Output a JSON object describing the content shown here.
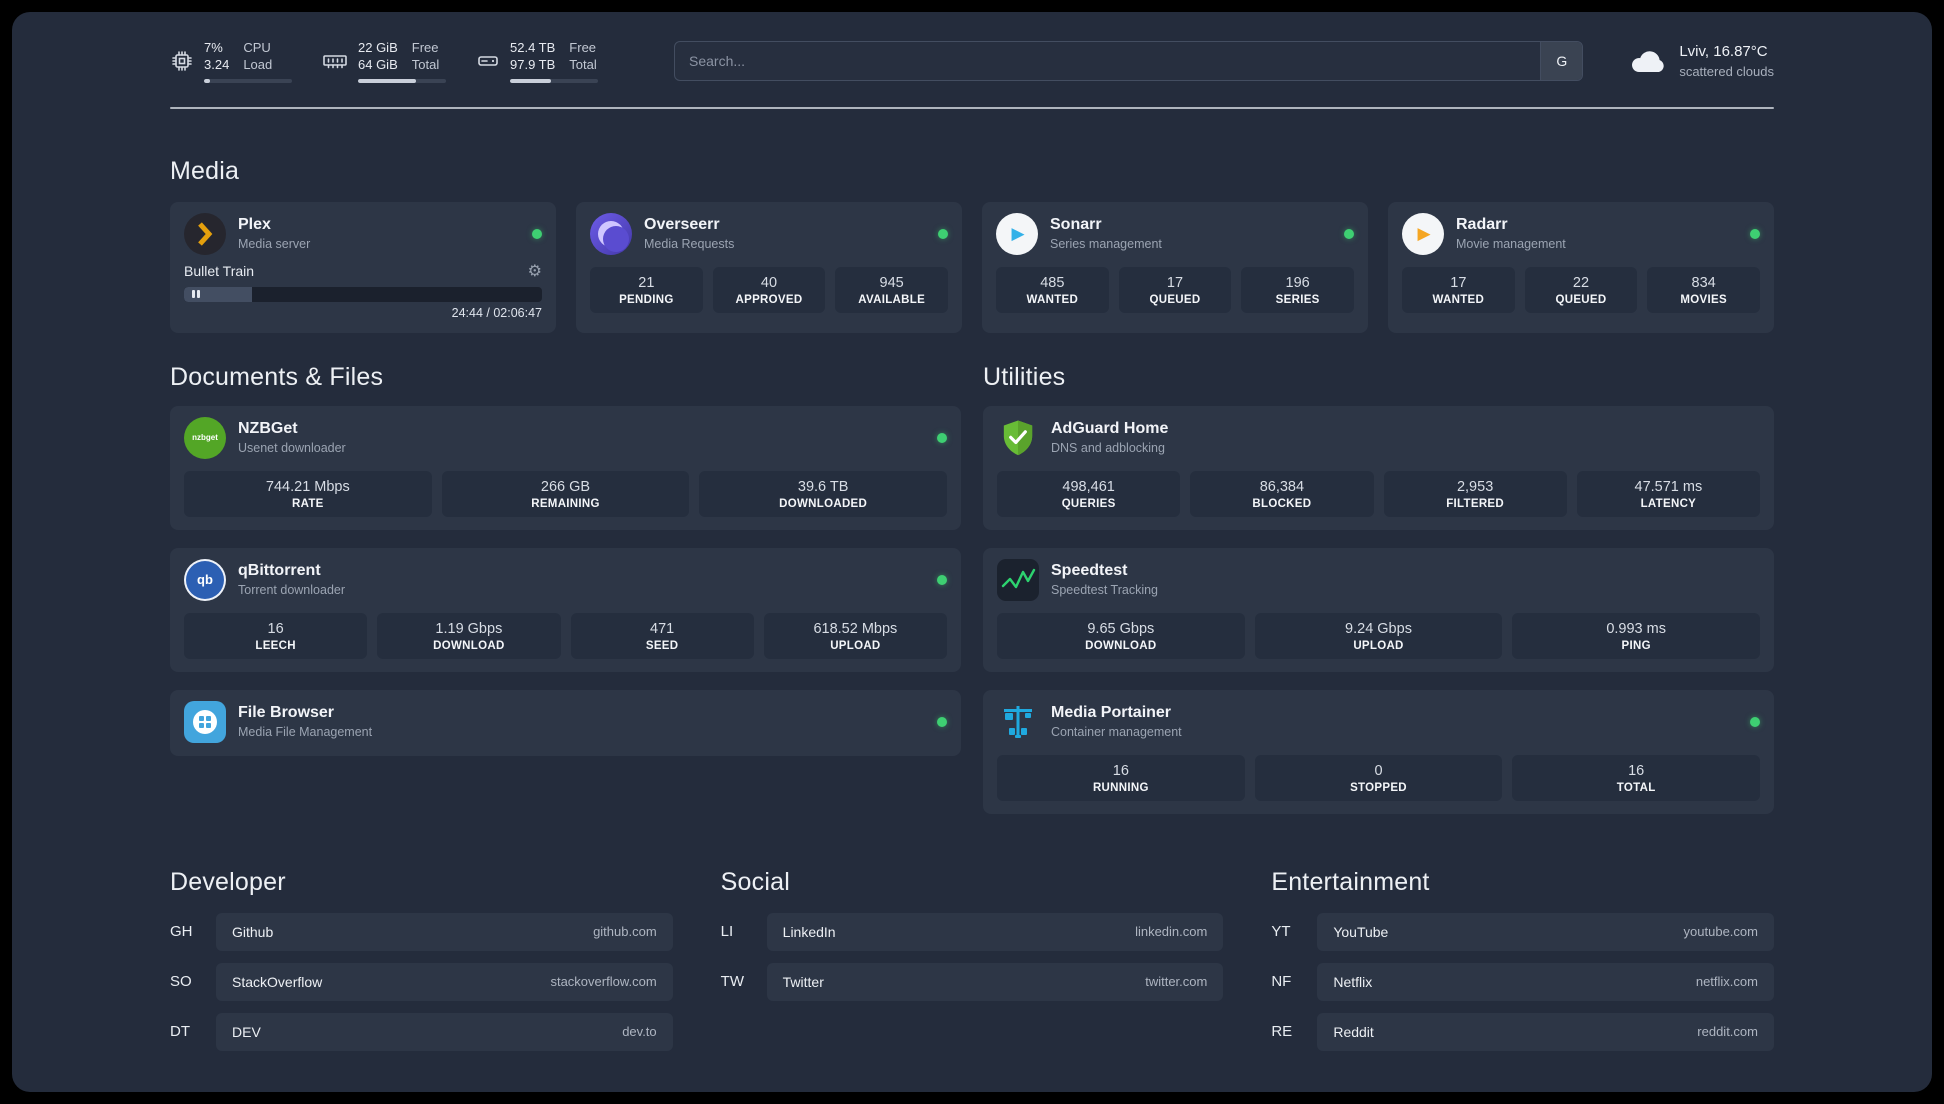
{
  "topbar": {
    "cpu": {
      "percent": "7%",
      "load": "3.24",
      "label_top": "CPU",
      "label_bottom": "Load",
      "bar": 7
    },
    "ram": {
      "free": "22 GiB",
      "total": "64 GiB",
      "label_top": "Free",
      "label_bottom": "Total",
      "bar": 66
    },
    "disk": {
      "free": "52.4 TB",
      "total": "97.9 TB",
      "label_top": "Free",
      "label_bottom": "Total",
      "bar": 47
    },
    "search": {
      "placeholder": "Search...",
      "button": "G"
    },
    "weather": {
      "location": "Lviv, 16.87°C",
      "condition": "scattered clouds"
    }
  },
  "media": {
    "heading": "Media",
    "plex": {
      "name": "Plex",
      "subtitle": "Media server",
      "player": {
        "title": "Bullet Train",
        "time": "24:44 / 02:06:47",
        "progress": 19
      }
    },
    "overseerr": {
      "name": "Overseerr",
      "subtitle": "Media Requests",
      "stats": [
        {
          "value": "21",
          "label": "PENDING"
        },
        {
          "value": "40",
          "label": "APPROVED"
        },
        {
          "value": "945",
          "label": "AVAILABLE"
        }
      ]
    },
    "sonarr": {
      "name": "Sonarr",
      "subtitle": "Series management",
      "stats": [
        {
          "value": "485",
          "label": "WANTED"
        },
        {
          "value": "17",
          "label": "QUEUED"
        },
        {
          "value": "196",
          "label": "SERIES"
        }
      ]
    },
    "radarr": {
      "name": "Radarr",
      "subtitle": "Movie management",
      "stats": [
        {
          "value": "17",
          "label": "WANTED"
        },
        {
          "value": "22",
          "label": "QUEUED"
        },
        {
          "value": "834",
          "label": "MOVIES"
        }
      ]
    }
  },
  "documents": {
    "heading": "Documents & Files",
    "nzbget": {
      "name": "NZBGet",
      "subtitle": "Usenet downloader",
      "stats": [
        {
          "value": "744.21 Mbps",
          "label": "RATE"
        },
        {
          "value": "266 GB",
          "label": "REMAINING"
        },
        {
          "value": "39.6 TB",
          "label": "DOWNLOADED"
        }
      ]
    },
    "qbittorrent": {
      "name": "qBittorrent",
      "subtitle": "Torrent downloader",
      "stats": [
        {
          "value": "16",
          "label": "LEECH"
        },
        {
          "value": "1.19 Gbps",
          "label": "DOWNLOAD"
        },
        {
          "value": "471",
          "label": "SEED"
        },
        {
          "value": "618.52 Mbps",
          "label": "UPLOAD"
        }
      ]
    },
    "filebrowser": {
      "name": "File Browser",
      "subtitle": "Media File Management"
    }
  },
  "utilities": {
    "heading": "Utilities",
    "adguard": {
      "name": "AdGuard Home",
      "subtitle": "DNS and adblocking",
      "stats": [
        {
          "value": "498,461",
          "label": "QUERIES"
        },
        {
          "value": "86,384",
          "label": "BLOCKED"
        },
        {
          "value": "2,953",
          "label": "FILTERED"
        },
        {
          "value": "47.571 ms",
          "label": "LATENCY"
        }
      ]
    },
    "speedtest": {
      "name": "Speedtest",
      "subtitle": "Speedtest Tracking",
      "stats": [
        {
          "value": "9.65 Gbps",
          "label": "DOWNLOAD"
        },
        {
          "value": "9.24 Gbps",
          "label": "UPLOAD"
        },
        {
          "value": "0.993 ms",
          "label": "PING"
        }
      ]
    },
    "portainer": {
      "name": "Media Portainer",
      "subtitle": "Container management",
      "stats": [
        {
          "value": "16",
          "label": "RUNNING"
        },
        {
          "value": "0",
          "label": "STOPPED"
        },
        {
          "value": "16",
          "label": "TOTAL"
        }
      ]
    }
  },
  "links": {
    "developer": {
      "heading": "Developer",
      "items": [
        {
          "abbr": "GH",
          "name": "Github",
          "url": "github.com"
        },
        {
          "abbr": "SO",
          "name": "StackOverflow",
          "url": "stackoverflow.com"
        },
        {
          "abbr": "DT",
          "name": "DEV",
          "url": "dev.to"
        }
      ]
    },
    "social": {
      "heading": "Social",
      "items": [
        {
          "abbr": "LI",
          "name": "LinkedIn",
          "url": "linkedin.com"
        },
        {
          "abbr": "TW",
          "name": "Twitter",
          "url": "twitter.com"
        }
      ]
    },
    "entertainment": {
      "heading": "Entertainment",
      "items": [
        {
          "abbr": "YT",
          "name": "YouTube",
          "url": "youtube.com"
        },
        {
          "abbr": "NF",
          "name": "Netflix",
          "url": "netflix.com"
        },
        {
          "abbr": "RE",
          "name": "Reddit",
          "url": "reddit.com"
        }
      ]
    }
  },
  "icons": {
    "nzbget_text": "nzbget",
    "qbittorrent_text": "qb",
    "sonarr_glyph": "▶",
    "radarr_glyph": "▶",
    "gear_glyph": "⚙"
  },
  "colors": {
    "status_online": "#3ecf72",
    "plex_accent": "#e5a00d"
  }
}
